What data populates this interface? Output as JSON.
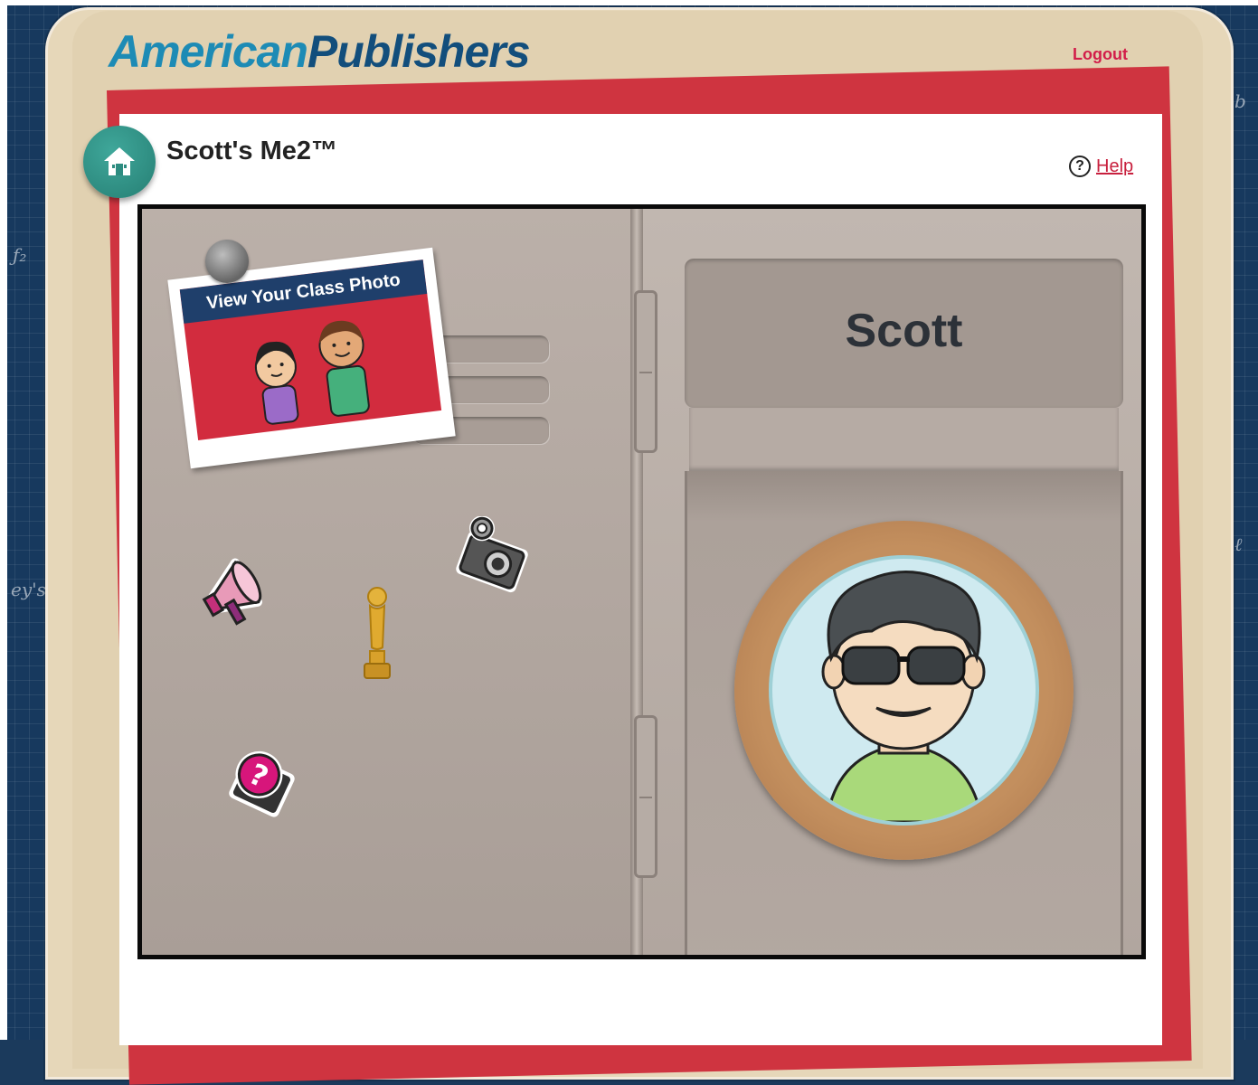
{
  "header": {
    "logo_part1": "American",
    "logo_part2": "Publishers",
    "logout_label": "Logout"
  },
  "page": {
    "title": "Scott's Me2™",
    "help_label": "Help",
    "help_icon": "?"
  },
  "locker": {
    "owner_name": "Scott",
    "class_photo_label": "View Your Class Photo",
    "stickers": [
      "megaphone-sticker",
      "trophy-sticker",
      "camera-sticker",
      "question-mark-sticker"
    ]
  },
  "colors": {
    "logo_light": "#1d8bb5",
    "logo_dark": "#124e7c",
    "logout": "#d21d4a",
    "home_button": "#2d8c80",
    "red_paper": "#cf3440",
    "frame": "#e6d7b9",
    "locker": "#b7aba4"
  }
}
